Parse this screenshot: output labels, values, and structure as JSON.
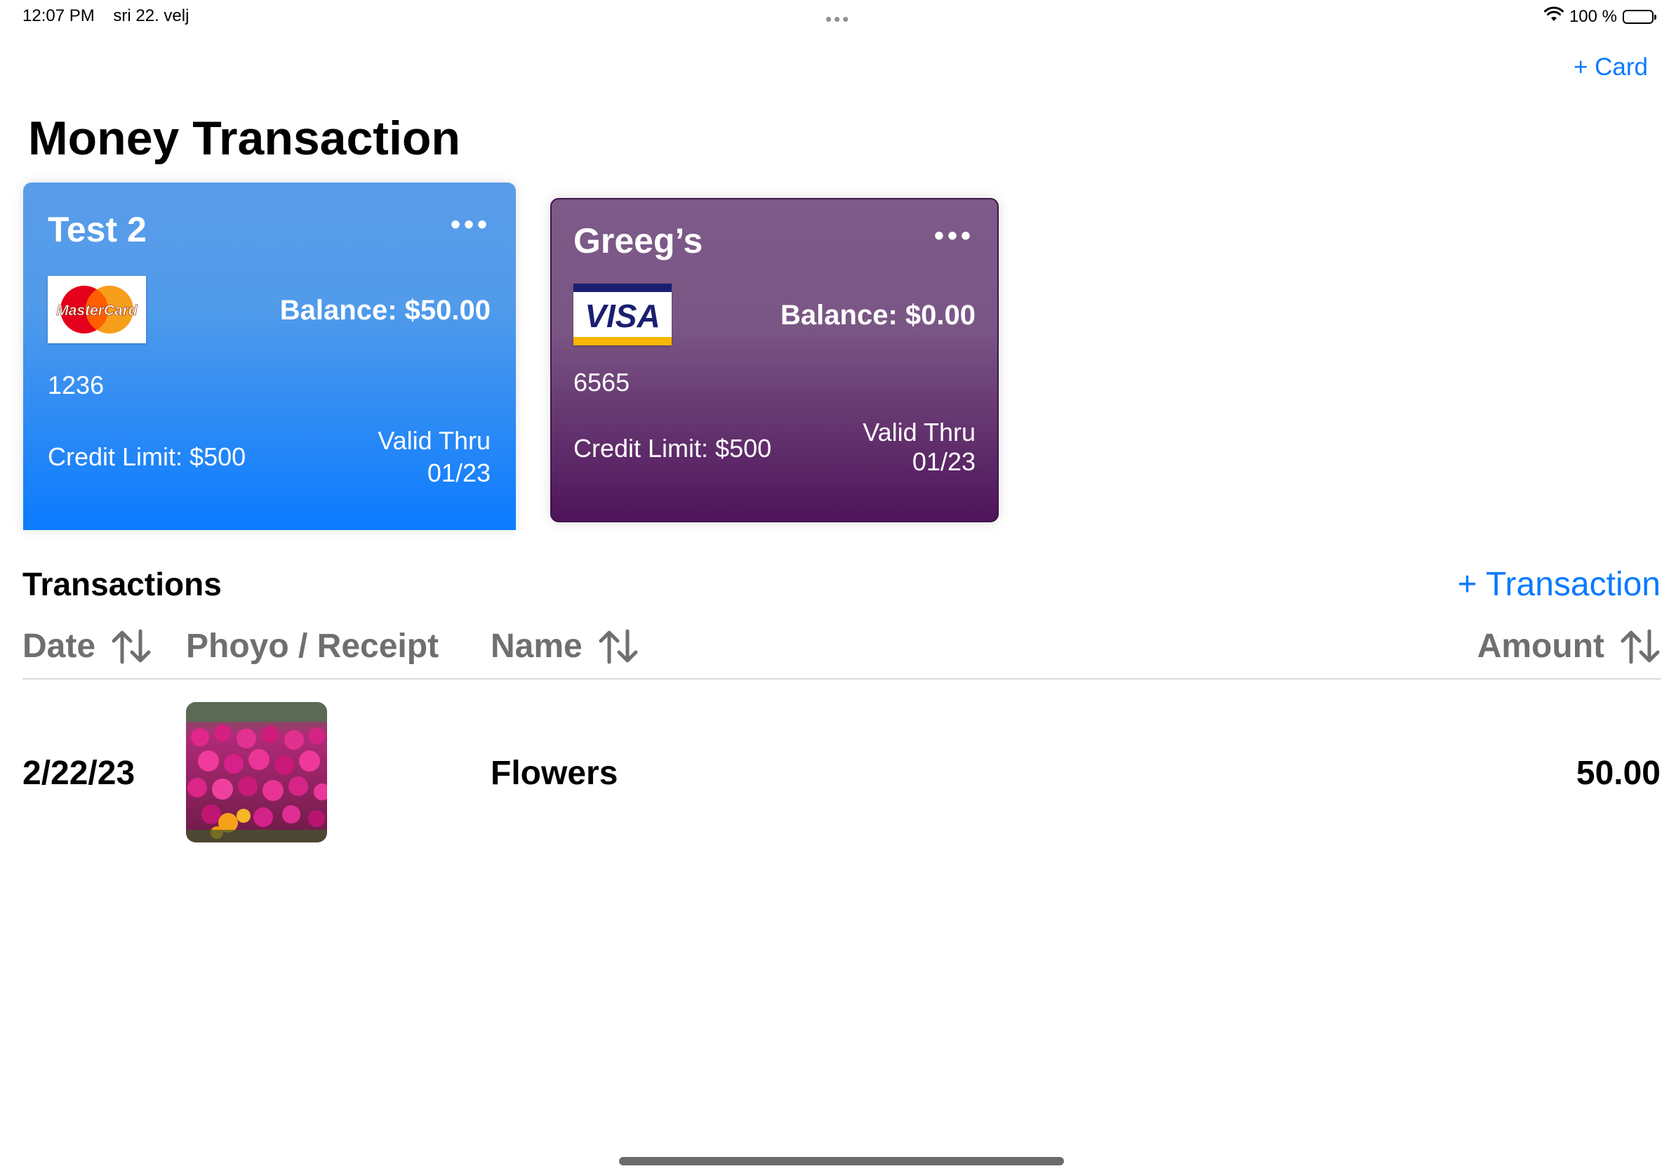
{
  "status_bar": {
    "time": "12:07 PM",
    "date": "sri 22. velj",
    "dots": "•••",
    "battery_text": "100 %",
    "wifi_icon": "wifi-icon",
    "battery_icon": "battery-icon"
  },
  "header": {
    "add_card_label": "+ Card",
    "title": "Money Transaction"
  },
  "cards": [
    {
      "name": "Test 2",
      "menu": "•••",
      "brand": "MasterCard",
      "balance": "Balance: $50.00",
      "number": "1236",
      "credit_limit": "Credit Limit: $500",
      "valid_thru_label": "Valid Thru",
      "valid_thru": "01/23",
      "color": "#0b7bff"
    },
    {
      "name": "Greeg’s",
      "menu": "•••",
      "brand": "VISA",
      "balance": "Balance: $0.00",
      "number": "6565",
      "credit_limit": "Credit Limit: $500",
      "valid_thru_label": "Valid Thru",
      "valid_thru": "01/23",
      "color": "#4f145a"
    }
  ],
  "transactions": {
    "title": "Transactions",
    "add_label": "+ Transaction",
    "columns": {
      "date": "Date",
      "photo": "Phoyo / Receipt",
      "name": "Name",
      "amount": "Amount"
    },
    "rows": [
      {
        "date": "2/22/23",
        "photo": "flowers-photo",
        "name": "Flowers",
        "amount": "50.00"
      }
    ]
  },
  "colors": {
    "accent": "#0a7aff",
    "header_gray": "#6f6f6f"
  }
}
